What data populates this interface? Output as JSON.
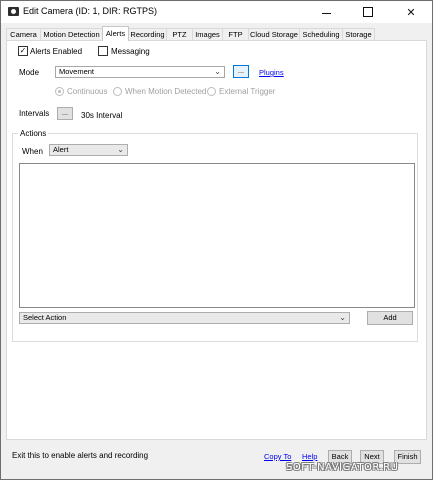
{
  "window": {
    "title": "Edit Camera (ID: 1, DIR: RGTPS)",
    "controls": [
      "minimize",
      "maximize",
      "close"
    ]
  },
  "tabs": [
    {
      "label": "Camera",
      "active": false
    },
    {
      "label": "Motion Detection",
      "active": false
    },
    {
      "label": "Alerts",
      "active": true
    },
    {
      "label": "Recording",
      "active": false
    },
    {
      "label": "PTZ",
      "active": false
    },
    {
      "label": "Images",
      "active": false
    },
    {
      "label": "FTP",
      "active": false
    },
    {
      "label": "Cloud Storage",
      "active": false
    },
    {
      "label": "Scheduling",
      "active": false
    },
    {
      "label": "Storage",
      "active": false
    }
  ],
  "alerts": {
    "alerts_enabled": {
      "label": "Alerts Enabled",
      "checked": true
    },
    "messaging": {
      "label": "Messaging",
      "checked": false
    },
    "mode": {
      "label": "Mode",
      "value": "Movement",
      "browse_label": "...",
      "plugins_link": "Plugins"
    },
    "radios": [
      {
        "label": "Continuous",
        "checked": true
      },
      {
        "label": "When Motion Detected",
        "checked": false
      },
      {
        "label": "External Trigger",
        "checked": false
      }
    ],
    "intervals": {
      "label": "Intervals",
      "button_label": "...",
      "value_text": "30s Interval"
    },
    "actions": {
      "group_label": "Actions",
      "when_label": "When",
      "when_value": "Alert",
      "list_items": [],
      "select_action_value": "Select Action",
      "add_label": "Add"
    }
  },
  "status": {
    "hint": "Exit this to enable alerts and recording",
    "copy_link": "Copy To",
    "help_link": "Help",
    "back_label": "Back",
    "next_label": "Next",
    "finish_label": "Finish"
  },
  "watermark": "SOFT-NAVIGATOR.RU",
  "colors": {
    "link": "#0000ee",
    "focus_border": "#0078d7",
    "panel": "#ffffff",
    "chrome": "#f0f0f0"
  }
}
